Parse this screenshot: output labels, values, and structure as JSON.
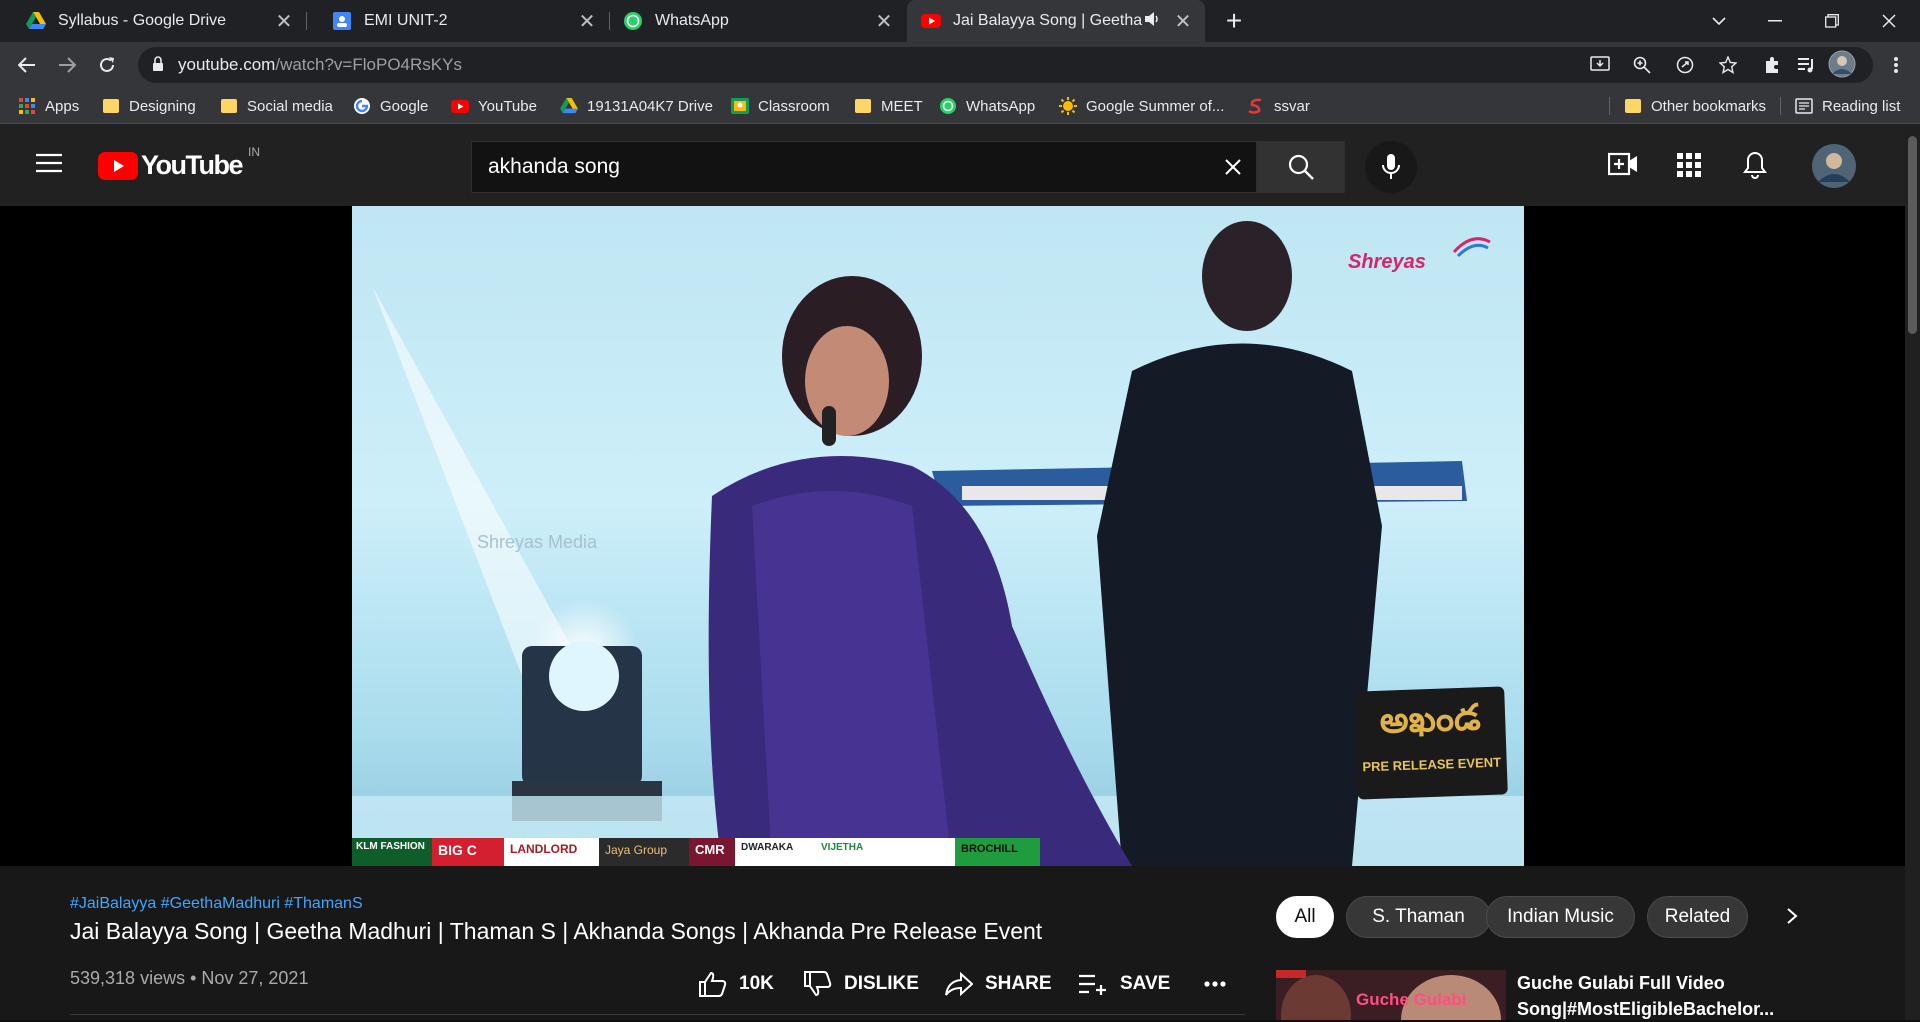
{
  "browser": {
    "tabs": [
      {
        "title": "Syllabus - Google Drive",
        "icon": "google-drive-icon",
        "active": false
      },
      {
        "title": "EMI UNIT-2",
        "icon": "classroom-icon",
        "active": false
      },
      {
        "title": "WhatsApp",
        "icon": "whatsapp-icon",
        "active": false
      },
      {
        "title": "Jai Balayya Song | Geetha Ma",
        "icon": "youtube-icon",
        "active": true
      }
    ],
    "address": {
      "domain": "youtube.com",
      "path": "/watch?v=FloPO4RsKYs"
    },
    "bookmarks": [
      {
        "label": "Apps",
        "icon": "apps-grid-icon"
      },
      {
        "label": "Designing",
        "icon": "folder-icon"
      },
      {
        "label": "Social media",
        "icon": "folder-icon"
      },
      {
        "label": "Google",
        "icon": "google-icon"
      },
      {
        "label": "YouTube",
        "icon": "youtube-icon"
      },
      {
        "label": "19131A04K7 Drive",
        "icon": "google-drive-icon"
      },
      {
        "label": "Classroom",
        "icon": "classroom-icon"
      },
      {
        "label": "MEET",
        "icon": "folder-icon"
      },
      {
        "label": "WhatsApp",
        "icon": "whatsapp-icon"
      },
      {
        "label": "Google Summer of...",
        "icon": "sun-icon"
      },
      {
        "label": "ssvar",
        "icon": "ssvar-icon"
      }
    ],
    "other_bookmarks": "Other bookmarks",
    "reading_list": "Reading list"
  },
  "youtube": {
    "logo_text": "YouTube",
    "region": "IN",
    "search_value": "akhanda song",
    "video": {
      "watermark": "Shreyas",
      "event_badge_title": "అఖండ",
      "event_badge_sub": "PRE RELEASE EVENT",
      "faint_watermark": "Shreyas Media",
      "sponsors": [
        "KLM FASHION",
        "BIG C",
        "LANDLORD",
        "Jaya Group",
        "CMR",
        "DWARAKA",
        "VIJETHA",
        "BROCHILL"
      ]
    },
    "hashtags": "#JaiBalayya #GeethaMadhuri #ThamanS",
    "title": "Jai Balayya Song | Geetha Madhuri | Thaman S | Akhanda Songs | Akhanda Pre Release Event",
    "meta": "539,318 views • Nov 27, 2021",
    "actions": {
      "like": "10K",
      "dislike": "DISLIKE",
      "share": "SHARE",
      "save": "SAVE"
    },
    "chips": [
      "All",
      "S. Thaman",
      "Indian Music",
      "Related"
    ],
    "related": {
      "title_line1": "Guche Gulabi Full Video",
      "title_line2": "Song|#MostEligibleBachelor...",
      "thumb_text": "Guche Gulabi"
    }
  },
  "colors": {
    "youtube_red": "#ff0000",
    "chrome_dark": "#202124",
    "yt_bg": "#181818",
    "hashtag_blue": "#3ea6ff"
  }
}
